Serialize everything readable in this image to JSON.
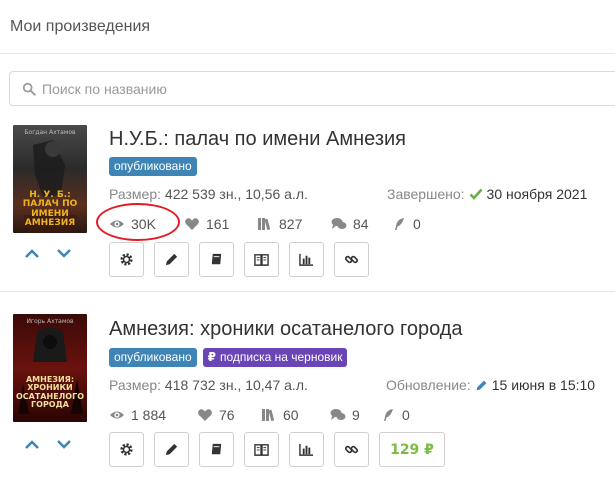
{
  "header": {
    "title": "Мои произведения"
  },
  "search": {
    "placeholder": "Поиск по названию"
  },
  "colors": {
    "accent": "#3e84b5",
    "check": "#67b045",
    "price": "#7bbd43",
    "annotation": "#e31b23",
    "subscription": "#6a45b5"
  },
  "works": [
    {
      "cover": {
        "author": "Богдан Ахтамов",
        "title": "Н. У. Б.: ПАЛАЧ ПО ИМЕНИ АМНЕЗИЯ"
      },
      "title": "Н.У.Б.: палач по имени Амнезия",
      "badges": [
        "опубликовано"
      ],
      "size_label": "Размер:",
      "size_value": "422 539 зн., 10,56 а.л.",
      "status_label": "Завершено:",
      "status_value": "30 ноября 2021",
      "stats": {
        "views": "30K",
        "likes": "161",
        "library": "827",
        "comments": "84",
        "awards": "0"
      },
      "buttons": [
        "settings",
        "edit",
        "book",
        "read",
        "stats",
        "link"
      ]
    },
    {
      "cover": {
        "author": "Игорь Ахтамов",
        "title": "АМНЕЗИЯ: ХРОНИКИ ОСАТАНЕЛОГО ГОРОДА"
      },
      "title": "Амнезия: хроники осатанелого города",
      "badges": [
        "опубликовано",
        "подписка на черновик"
      ],
      "size_label": "Размер:",
      "size_value": "418 732 зн., 10,47 а.л.",
      "status_label": "Обновление:",
      "status_value": "15 июня в 15:10",
      "stats": {
        "views": "1 884",
        "likes": "76",
        "library": "60",
        "comments": "9",
        "awards": "0"
      },
      "buttons": [
        "settings",
        "edit",
        "book",
        "read",
        "stats",
        "link"
      ],
      "price": "129 ₽"
    }
  ]
}
